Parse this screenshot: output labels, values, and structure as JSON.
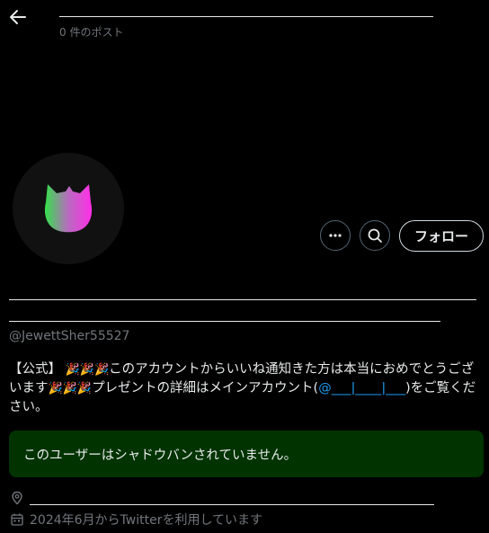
{
  "header": {
    "post_count": "0 件のポスト"
  },
  "profile": {
    "follow_label": "フォロー",
    "handle": "@JewettSher55527",
    "bio_prefix": "【公式】 ",
    "bio_emoji_1": "🎉🎉🎉",
    "bio_text_1": "このアカウントからいいね通知きた方は本当におめでとうございます",
    "bio_emoji_2": "🎉🎉🎉",
    "bio_text_2": "プレゼントの詳細はメインアカウント(",
    "bio_link": "@___|____|___",
    "bio_text_3": ")をご覧ください。",
    "joined": "2024年6月からTwitterを利用しています"
  },
  "notice": {
    "text": "このユーザーはシャドウバンされていません。"
  },
  "colors": {
    "background": "#000000",
    "link": "#1d9bf0",
    "notice_bg": "#003300",
    "secondary_text": "#71767b"
  },
  "icons": {
    "back": "arrow-left-icon",
    "more": "more-dots-icon",
    "search": "search-icon",
    "location": "location-pin-icon",
    "calendar": "calendar-icon",
    "avatar": "cat-head-icon"
  }
}
